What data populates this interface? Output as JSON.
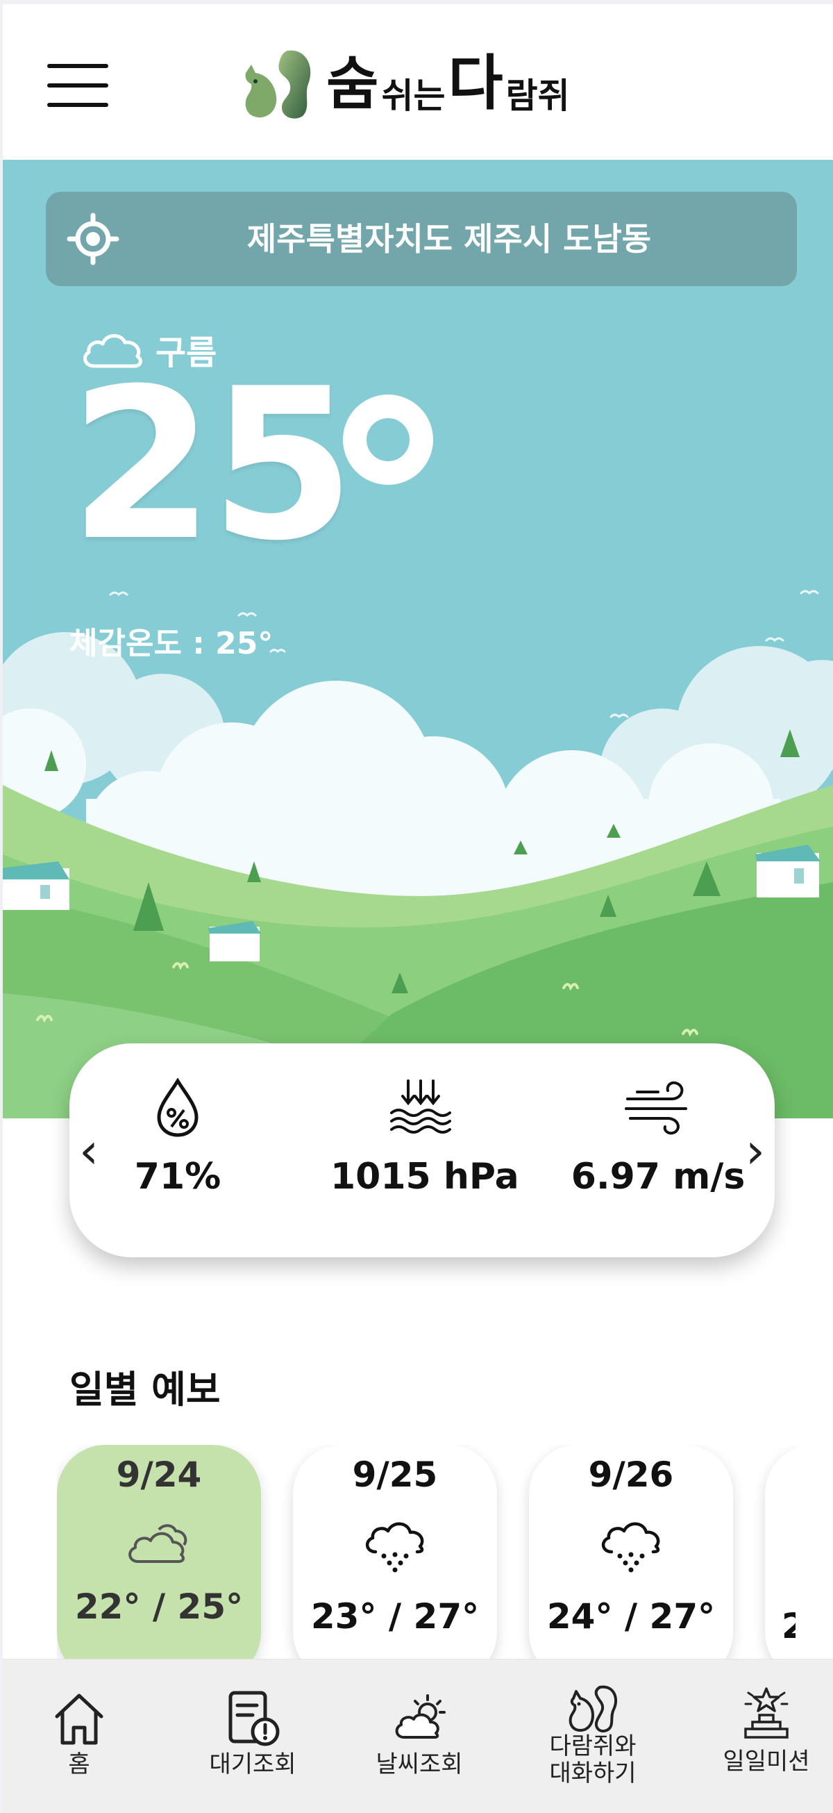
{
  "header": {
    "logo_part1": "숨",
    "logo_part2": "쉬는",
    "logo_part3": "다",
    "logo_part4": "람쥐"
  },
  "location": {
    "text": "제주특별자치도 제주시 도남동"
  },
  "weather": {
    "condition": "구름",
    "temperature": "25",
    "feels_like": "체감온도 : 25°"
  },
  "stats": {
    "humidity": "71%",
    "pressure": "1015 hPa",
    "wind": "6.97 m/s",
    "prev_arrow": "‹",
    "next_arrow": "›"
  },
  "daily": {
    "title": "일별 예보",
    "days": [
      {
        "date": "9/24",
        "icon": "cloud-icon",
        "temps": "22° / 25°"
      },
      {
        "date": "9/25",
        "icon": "rain-cloud-icon",
        "temps": "23° / 27°"
      },
      {
        "date": "9/26",
        "icon": "rain-cloud-icon",
        "temps": "24° / 27°"
      },
      {
        "date": "",
        "icon": "",
        "temps": "2"
      }
    ]
  },
  "nav": {
    "items": [
      {
        "label": "홈",
        "icon": "home-icon"
      },
      {
        "label": "대기조회",
        "icon": "air-report-icon"
      },
      {
        "label": "날씨조회",
        "icon": "weather-icon"
      },
      {
        "label": "다람쥐와\n대화하기",
        "icon": "squirrel-chat-icon"
      },
      {
        "label": "일일미션",
        "icon": "mission-trophy-icon"
      }
    ]
  },
  "colors": {
    "sky": "#86ccd5",
    "location_bar": "#73a6ab",
    "active_day": "#c5e1ac",
    "hill_light": "#8ccf7e",
    "hill_dark": "#5db25c"
  }
}
